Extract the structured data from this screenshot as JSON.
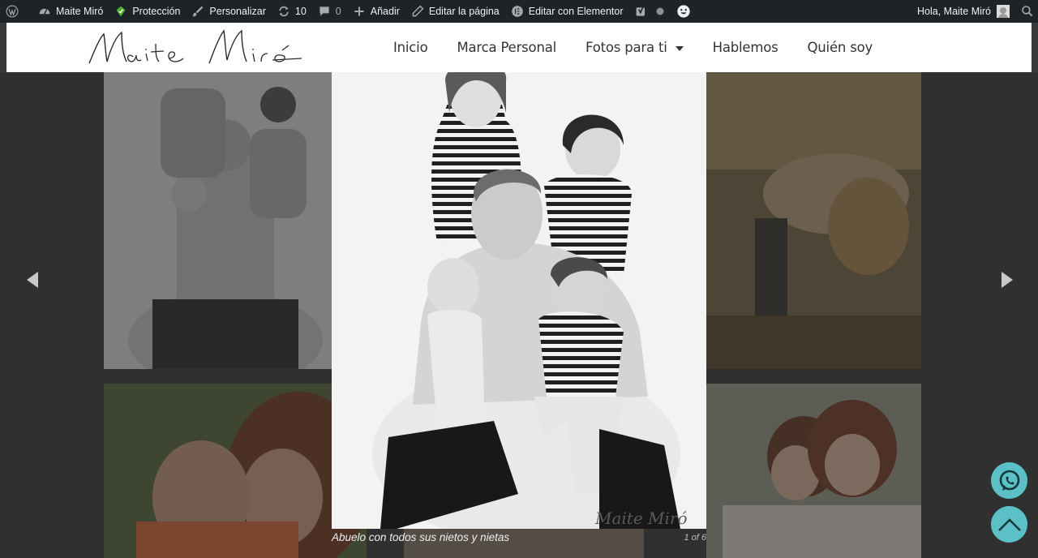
{
  "adminbar": {
    "site_name": "Maite Miró",
    "protection": "Protección",
    "customize": "Personalizar",
    "updates_count": "10",
    "comments_count": "0",
    "add_new": "Añadir",
    "edit_page": "Editar la página",
    "edit_elementor": "Editar con Elementor",
    "greeting": "Hola, Maite Miró"
  },
  "header": {
    "logo_text": "Maite Miró",
    "nav": {
      "inicio": "Inicio",
      "marca": "Marca Personal",
      "fotos": "Fotos para ti",
      "hablemos": "Hablemos",
      "quien": "Quién soy"
    }
  },
  "lightbox": {
    "caption": "Abuelo con todos sus nietos y nietas",
    "counter": "1 of 6",
    "watermark": "Maite Miró"
  },
  "colors": {
    "accent": "#5cc1c7",
    "adminbar": "#1d2327"
  },
  "icons": [
    "wordpress-icon",
    "dashboard-icon",
    "shield-icon",
    "brush-icon",
    "refresh-icon",
    "comment-icon",
    "plus-icon",
    "pencil-icon",
    "elementor-icon",
    "yoast-icon",
    "status-dot-icon",
    "smiley-icon",
    "search-icon",
    "whatsapp-icon",
    "chevron-up-icon",
    "arrow-left-icon",
    "arrow-right-icon"
  ]
}
